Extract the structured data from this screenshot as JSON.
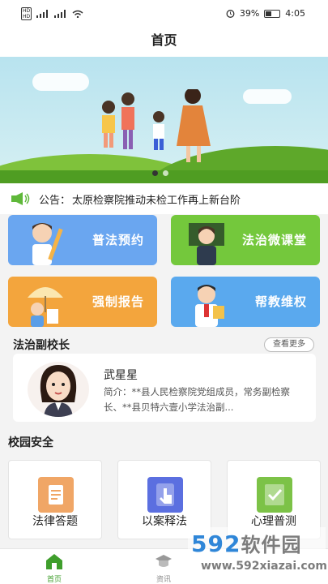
{
  "status_bar": {
    "time": "4:05",
    "battery_percent": "39%",
    "battery_level": 0.39
  },
  "header": {
    "title": "首页"
  },
  "banner": {
    "slide_count": 2,
    "active_slide": 1
  },
  "notice": {
    "label": "公告：",
    "text": "太原检察院推动未检工作再上新台阶"
  },
  "features": [
    {
      "label": "普法预约",
      "color": "#6aa6f0"
    },
    {
      "label": "法治微课堂",
      "color": "#74c83c"
    },
    {
      "label": "强制报告",
      "color": "#f3a53d"
    },
    {
      "label": "帮教维权",
      "color": "#5aa9ee"
    }
  ],
  "vice_principal": {
    "title": "法治副校长",
    "more": "查看更多",
    "name": "武星星",
    "intro": "简介：**县人民检察院党组成员，常务副检察长、**县贝特六壹小学法治副..."
  },
  "campus": {
    "title": "校园安全",
    "tiles": [
      {
        "label": "法律答题",
        "icon": "document-icon",
        "color": "#f0a666"
      },
      {
        "label": "以案释法",
        "icon": "hand-tap-icon",
        "color": "#5b6fe0"
      },
      {
        "label": "心理普测",
        "icon": "checklist-icon",
        "color": "#7cc247"
      }
    ]
  },
  "tabs": [
    {
      "label": "首页",
      "icon": "home-icon",
      "active": true
    },
    {
      "label": "资讯",
      "icon": "news-icon",
      "active": false
    }
  ],
  "watermark": {
    "number": "592",
    "chinese": "软件园",
    "url": "www.592xiazai.com"
  }
}
